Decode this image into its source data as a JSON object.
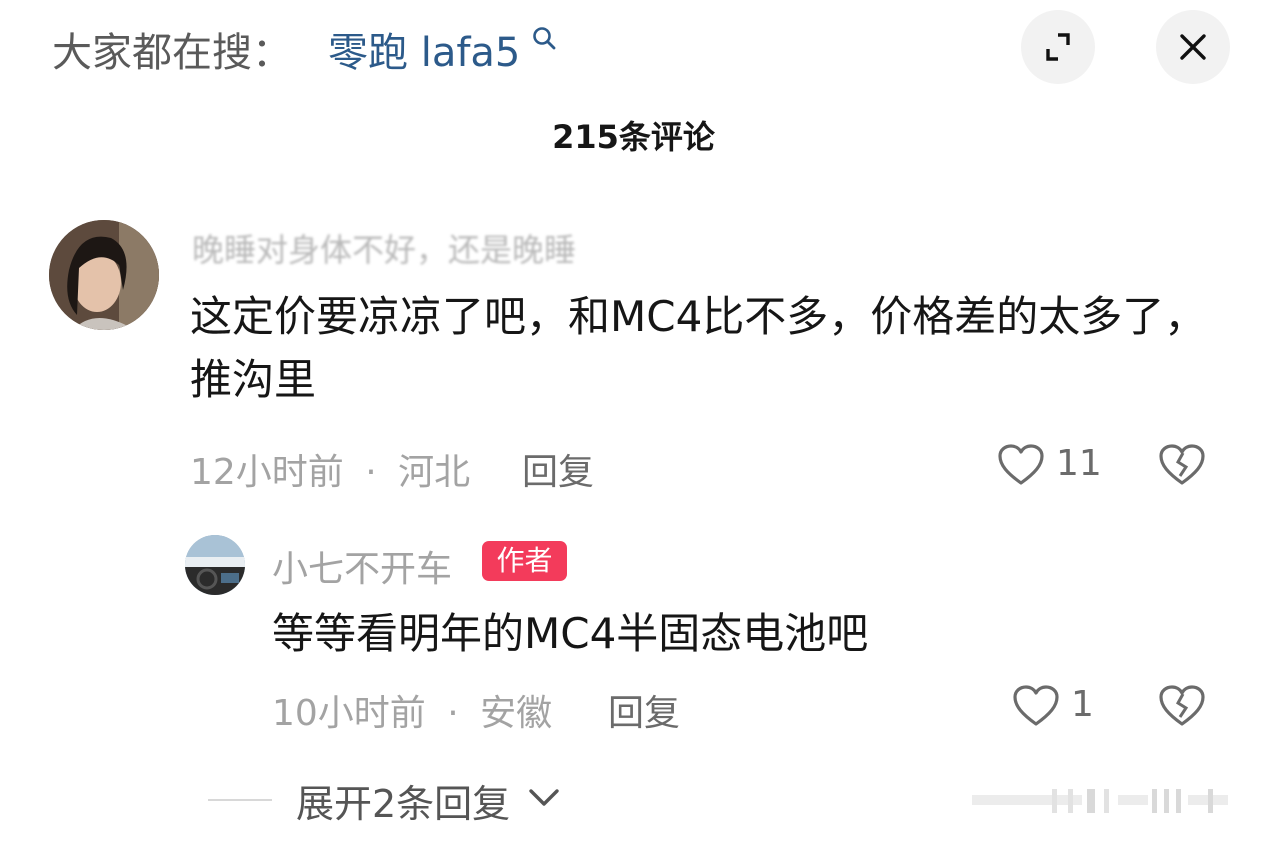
{
  "header": {
    "search_prefix": "大家都在搜：",
    "search_term": "零跑 lafa5",
    "icons": [
      "search-icon",
      "expand-icon",
      "close-icon"
    ]
  },
  "comment_count": "215条评论",
  "comments": [
    {
      "username": "晚睡对身体不好，还是晚睡",
      "text": "这定价要凉凉了吧，和MC4比不多，价格差的太多了，推沟里",
      "time": "12小时前",
      "location": "河北",
      "separator": "·",
      "reply_label": "回复",
      "likes": "11"
    }
  ],
  "replies": [
    {
      "username": "小七不开车",
      "badge": "作者",
      "text": "等等看明年的MC4半固态电池吧",
      "time": "10小时前",
      "location": "安徽",
      "separator": "·",
      "reply_label": "回复",
      "likes": "1"
    }
  ],
  "expand_replies_label": "展开2条回复",
  "colors": {
    "search_term": "#2c5a8a",
    "author_badge": "#f33b5b",
    "meta_text": "#a3a3a3"
  }
}
